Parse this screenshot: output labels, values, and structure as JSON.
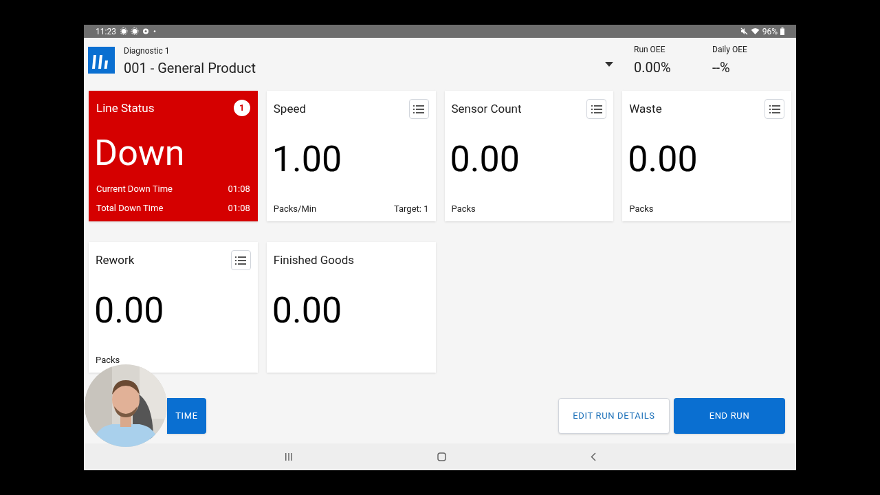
{
  "status_bar": {
    "time": "11:23",
    "battery": "96%"
  },
  "header": {
    "subtitle": "Diagnostic 1",
    "product": "001 - General Product",
    "metrics": [
      {
        "label": "Run OEE",
        "value": "0.00%"
      },
      {
        "label": "Daily OEE",
        "value": "--%"
      }
    ]
  },
  "cards": [
    {
      "kind": "status",
      "title": "Line Status",
      "badge": "1",
      "value": "Down",
      "rows": [
        {
          "label": "Current Down Time",
          "value": "01:08"
        },
        {
          "label": "Total Down Time",
          "value": "01:08"
        }
      ]
    },
    {
      "kind": "metric",
      "title": "Speed",
      "menu": true,
      "value": "1.00",
      "unit": "Packs/Min",
      "target": "Target: 1"
    },
    {
      "kind": "metric",
      "title": "Sensor Count",
      "menu": true,
      "value": "0.00",
      "unit": "Packs"
    },
    {
      "kind": "metric",
      "title": "Waste",
      "menu": true,
      "value": "0.00",
      "unit": "Packs"
    },
    {
      "kind": "metric",
      "title": "Rework",
      "menu": true,
      "value": "0.00",
      "unit": "Packs"
    },
    {
      "kind": "metric",
      "title": "Finished Goods",
      "menu": false,
      "value": "0.00"
    }
  ],
  "buttons": [
    {
      "label": "TIME",
      "kind": "primary"
    },
    {
      "label": "EDIT RUN DETAILS",
      "kind": "outline"
    },
    {
      "label": "END RUN",
      "kind": "primary"
    }
  ]
}
